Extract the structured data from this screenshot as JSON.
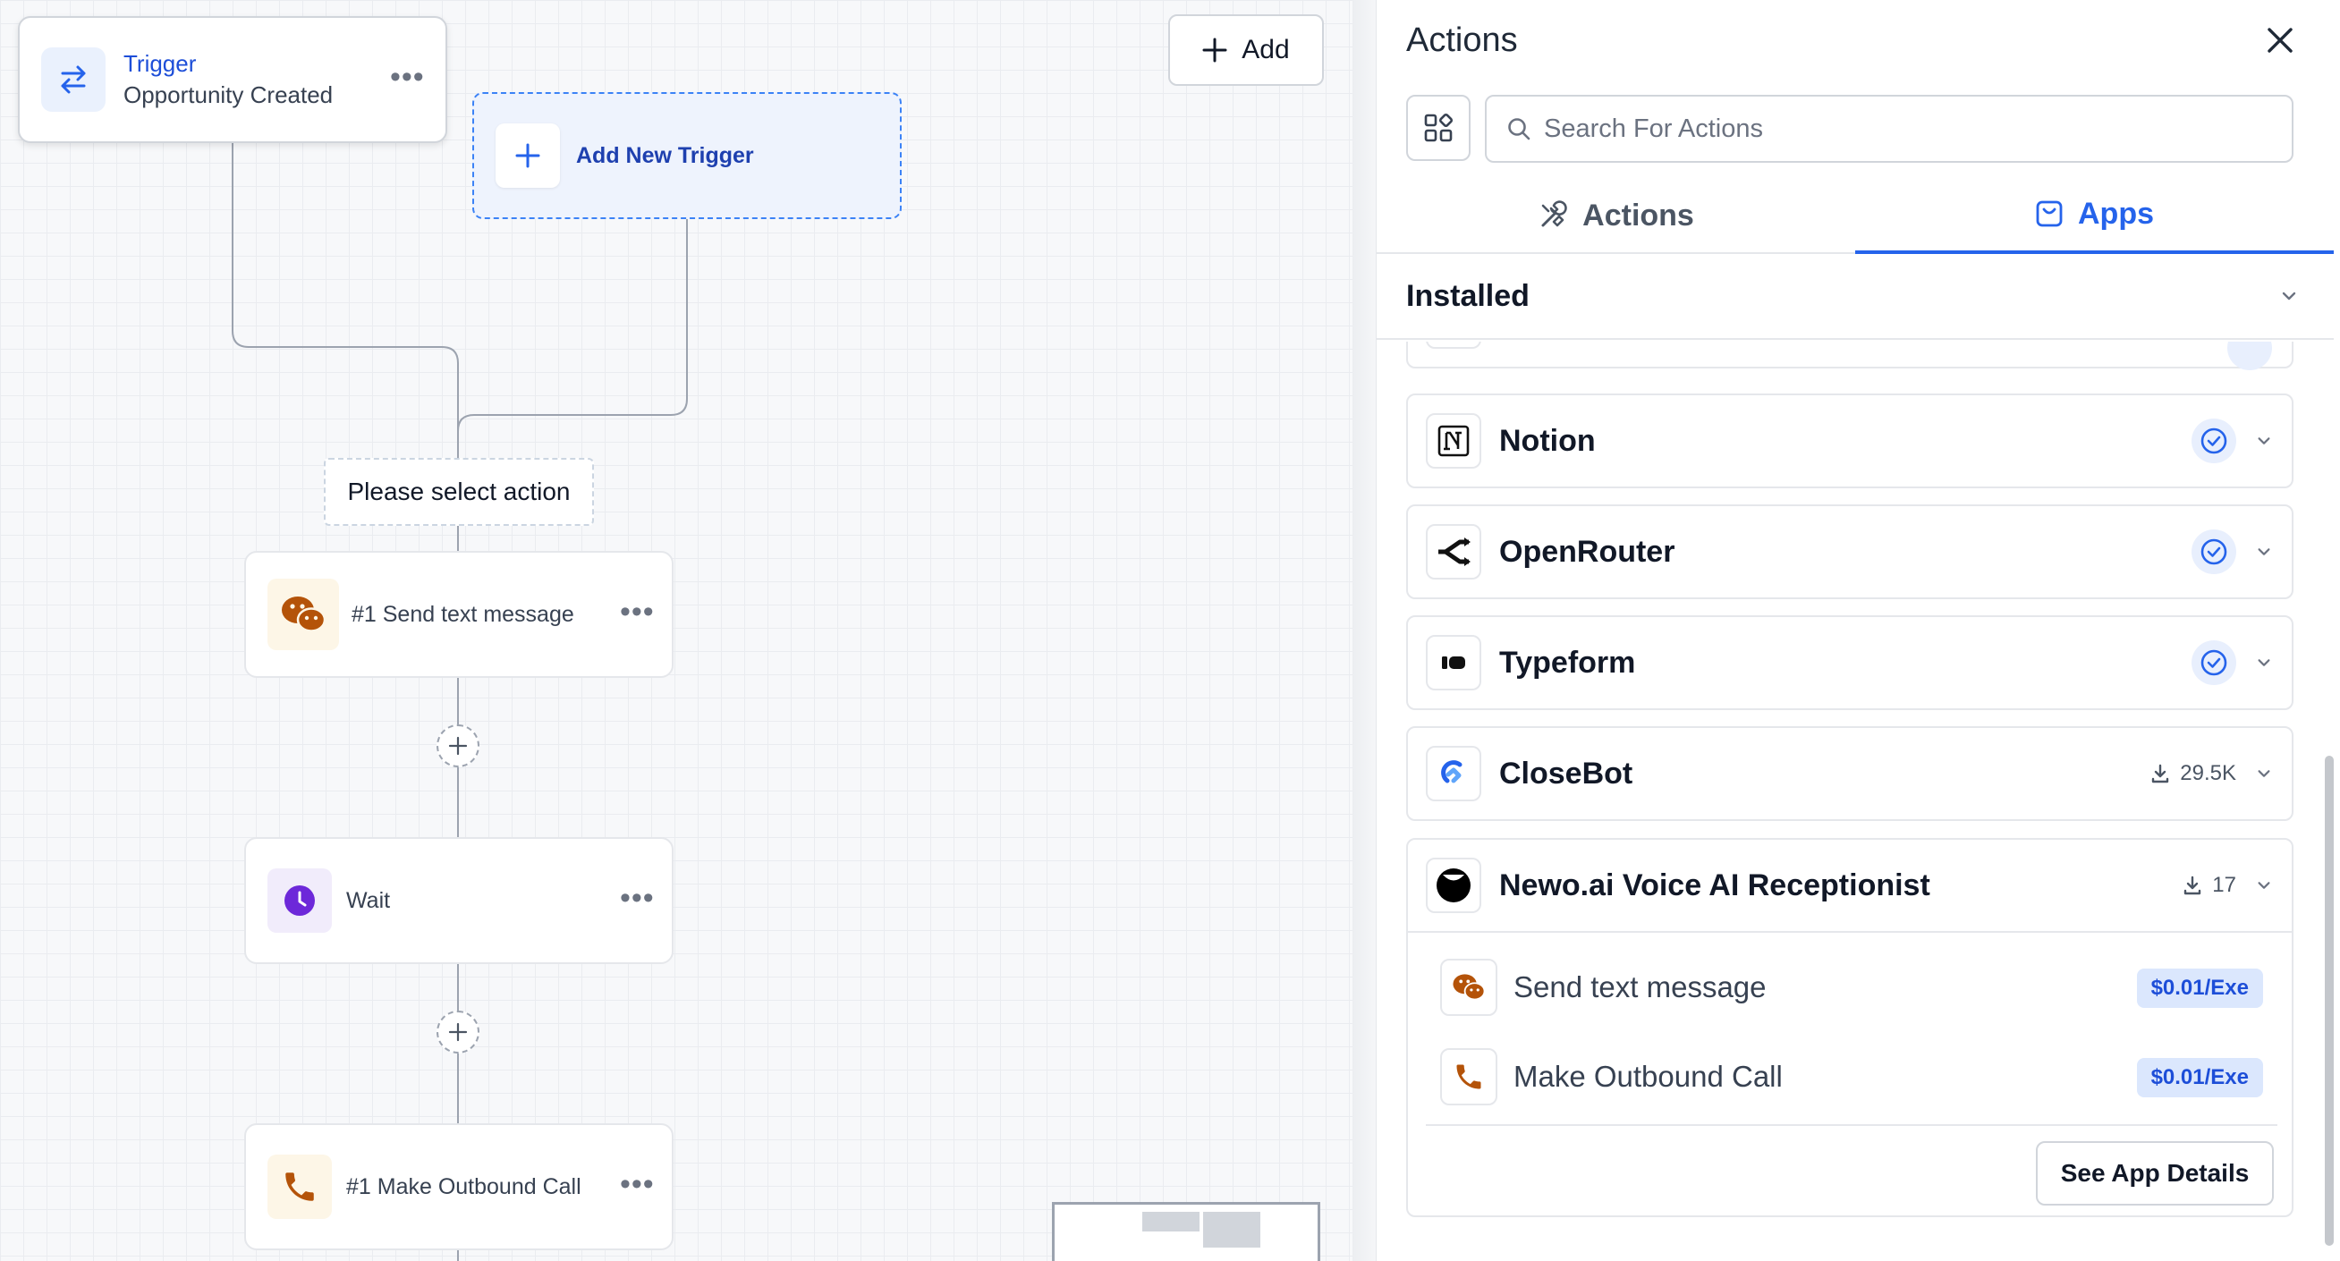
{
  "canvas": {
    "trigger": {
      "title": "Trigger",
      "subtitle": "Opportunity Created"
    },
    "add_new_trigger_label": "Add New Trigger",
    "add_button_label": "Add",
    "select_action_text": "Please select action",
    "nodes": [
      {
        "label": "#1 Send text message",
        "icon": "wechat-icon"
      },
      {
        "label": "Wait",
        "icon": "clock-icon"
      },
      {
        "label": "#1 Make Outbound Call",
        "icon": "phone-icon"
      }
    ]
  },
  "panel": {
    "title": "Actions",
    "search_placeholder": "Search For Actions",
    "tabs": [
      {
        "label": "Actions",
        "icon": "tools-icon",
        "active": false
      },
      {
        "label": "Apps",
        "icon": "app-store-icon",
        "active": true
      }
    ],
    "section_title": "Installed",
    "apps": [
      {
        "name": "Notion",
        "status": "installed",
        "icon": "notion-logo"
      },
      {
        "name": "OpenRouter",
        "status": "installed",
        "icon": "openrouter-logo"
      },
      {
        "name": "Typeform",
        "status": "installed",
        "icon": "typeform-logo"
      },
      {
        "name": "CloseBot",
        "downloads": "29.5K",
        "icon": "closebot-logo"
      }
    ],
    "expanded_app": {
      "name": "Newo.ai Voice AI Receptionist",
      "downloads": "17",
      "actions": [
        {
          "label": "Send text message",
          "price": "$0.01/Exe",
          "icon": "wechat-icon"
        },
        {
          "label": "Make Outbound Call",
          "price": "$0.01/Exe",
          "icon": "phone-icon"
        }
      ],
      "details_button": "See App Details"
    }
  },
  "colors": {
    "accent": "#2563eb",
    "trigger_bg": "#eef3fd",
    "action_icon": "#b45309",
    "wait_icon": "#6d28d9"
  }
}
